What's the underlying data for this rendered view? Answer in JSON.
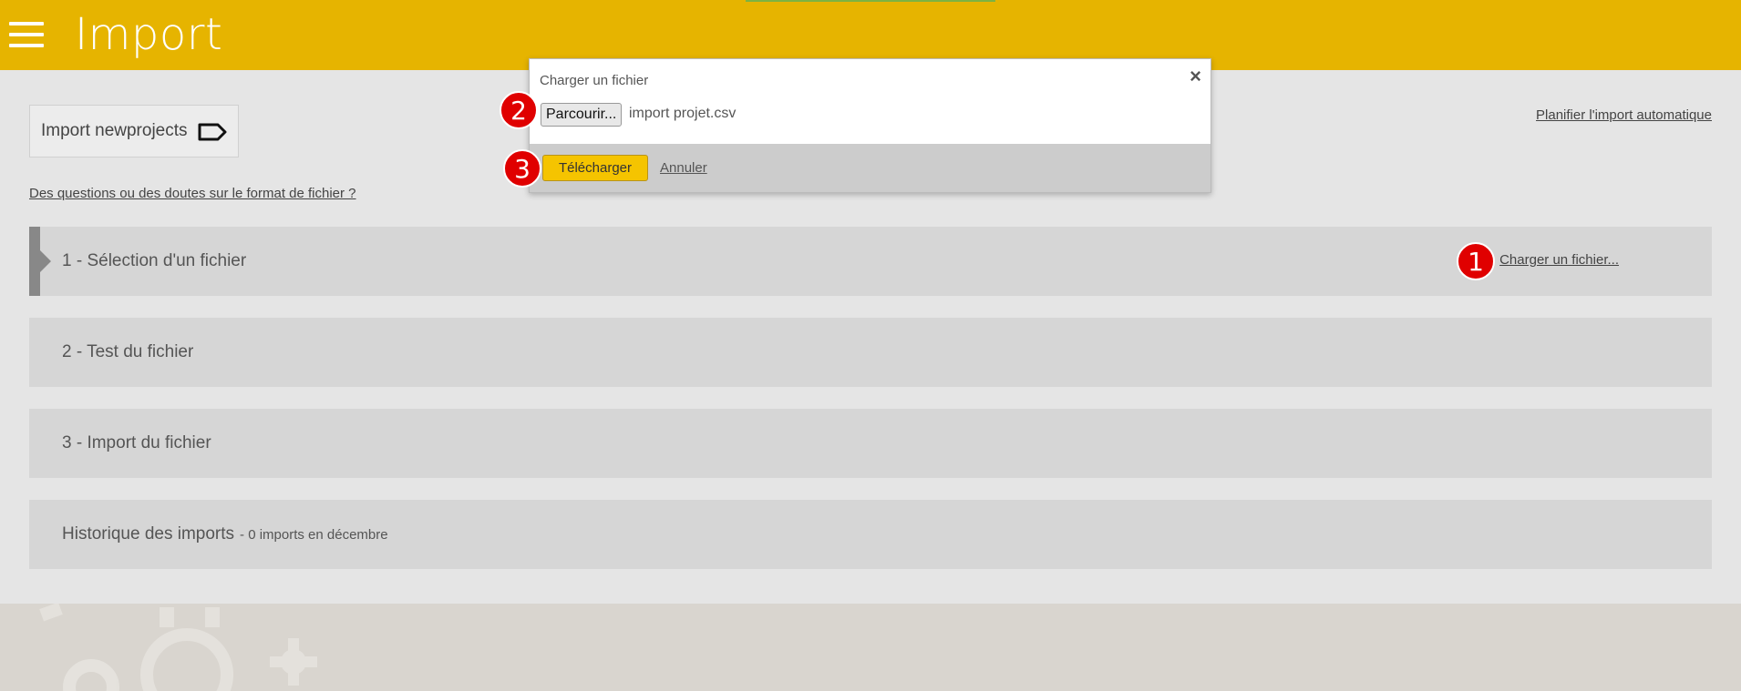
{
  "header": {
    "title": "Import",
    "accent_color": "#e6b400"
  },
  "profile": {
    "label": "Import newprojects",
    "icon": "tag-icon"
  },
  "links": {
    "format_help": "Des questions ou des doutes sur le format de fichier ?",
    "schedule": "Planifier l'import automatique",
    "load_file": "Charger un fichier..."
  },
  "steps": [
    {
      "label": "1 - Sélection d'un fichier"
    },
    {
      "label": "2 - Test du fichier"
    },
    {
      "label": "3 - Import du fichier"
    }
  ],
  "history": {
    "label": "Historique des imports",
    "sub": "- 0 imports en décembre"
  },
  "modal": {
    "title": "Charger un fichier",
    "close": "×",
    "browse_label": "Parcourir...",
    "file_name": "import projet.csv",
    "upload_label": "Télécharger",
    "cancel_label": "Annuler"
  },
  "badges": [
    "1",
    "2",
    "3"
  ]
}
